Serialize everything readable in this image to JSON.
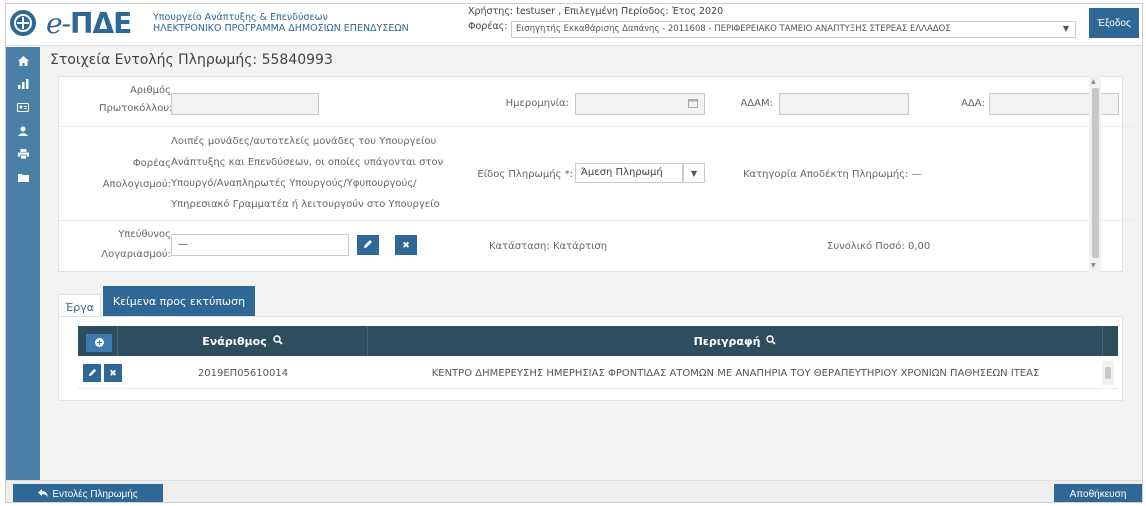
{
  "header": {
    "logo_prefix": "e-",
    "logo_main": "ΠΔΕ",
    "ministry_line1": "Υπουργείο Ανάπτυξης & Επενδύσεων",
    "ministry_line2": "ΗΛΕΚΤΡΟΝΙΚΟ ΠΡΟΓΡΑΜΜΑ ΔΗΜΟΣΙΩΝ ΕΠΕΝΔΥΣΕΩΝ",
    "user_line": "Χρήστης: testuser , Επιλεγμένη Περίοδος: Έτος 2020",
    "foreas_label": "Φορέας:",
    "foreas_value": "Εισηγητής Εκκαθάρισης Δαπάνης - 2011608 - ΠΕΡΙΦΕΡΕΙΑΚΟ ΤΑΜΕΙΟ ΑΝΑΠΤΥΞΗΣ ΣΤΕΡΕΑΣ ΕΛΛΑΔΟΣ",
    "exit_label": "Έξοδος"
  },
  "sidebar": {
    "icons": [
      "home-icon",
      "chart-icon",
      "id-card-icon",
      "user-icon",
      "print-icon",
      "folder-icon"
    ]
  },
  "page": {
    "title": "Στοιχεία Εντολής Πληρωμής: 55840993"
  },
  "form": {
    "protocol_label_1": "Αριθμός",
    "protocol_label_2": "Πρωτοκόλλου:",
    "protocol_value": "",
    "date_label": "Ημερομηνία:",
    "date_value": "",
    "adam_label": "ΑΔΑΜ:",
    "adam_value": "",
    "ada_label": "ΑΔΑ:",
    "ada_value": "",
    "foreas_apol_label_1": "Φορέας",
    "foreas_apol_label_2": "Απολογισμού:",
    "foreas_apol_lines": [
      "Λοιπές μονάδες/αυτοτελείς μονάδες του Υπουργείου",
      "Ανάπτυξης και Επενδύσεων, οι οποίες υπάγονται στον",
      "Υπουργό/Αναπληρωτές Υπουργούς/Υφυπουργούς/",
      "Υπηρεσιακό Γραμματέα ή λειτουργούν στο Υπουργείο"
    ],
    "payment_type_label": "Είδος Πληρωμής *:",
    "payment_type_value": "Άμεση Πληρωμή",
    "payee_category_label": "Κατηγορία Αποδέκτη Πληρωμής:",
    "payee_category_value": "—",
    "responsible_label_1": "Υπεύθυνος",
    "responsible_label_2": "Λογαριασμού:",
    "responsible_value": "—",
    "status_label": "Κατάσταση:",
    "status_value": "Κατάρτιση",
    "total_label": "Συνολικό Ποσό:",
    "total_value": "0,00"
  },
  "tabs": {
    "erga": "Έργα",
    "keimena": "Κείμενα προς εκτύπωση"
  },
  "table": {
    "columns": [
      "Ενάριθμος",
      "Περιγραφή"
    ],
    "rows": [
      {
        "enarithmos": "2019ΕΠ05610014",
        "perigrafi": "ΚΕΝΤΡΟ ΔΗΜΕΡΕΥΣΗΣ ΗΜΕΡΗΣΙΑΣ ΦΡΟΝΤΙΔΑΣ ΑΤΟΜΩΝ ΜΕ ΑΝΑΠΗΡΙΑ ΤΟΥ ΘΕΡΑΠΕΥΤΗΡΙΟΥ ΧΡΟΝΙΩΝ ΠΑΘΗΣΕΩΝ ΙΤΕΑΣ"
      }
    ]
  },
  "footer": {
    "back_label": "Εντολές Πληρωμής",
    "save_label": "Αποθήκευση"
  },
  "colors": {
    "primary": "#2f6796",
    "sidebar": "#4a7fa7",
    "table_header": "#2e4d5f"
  }
}
